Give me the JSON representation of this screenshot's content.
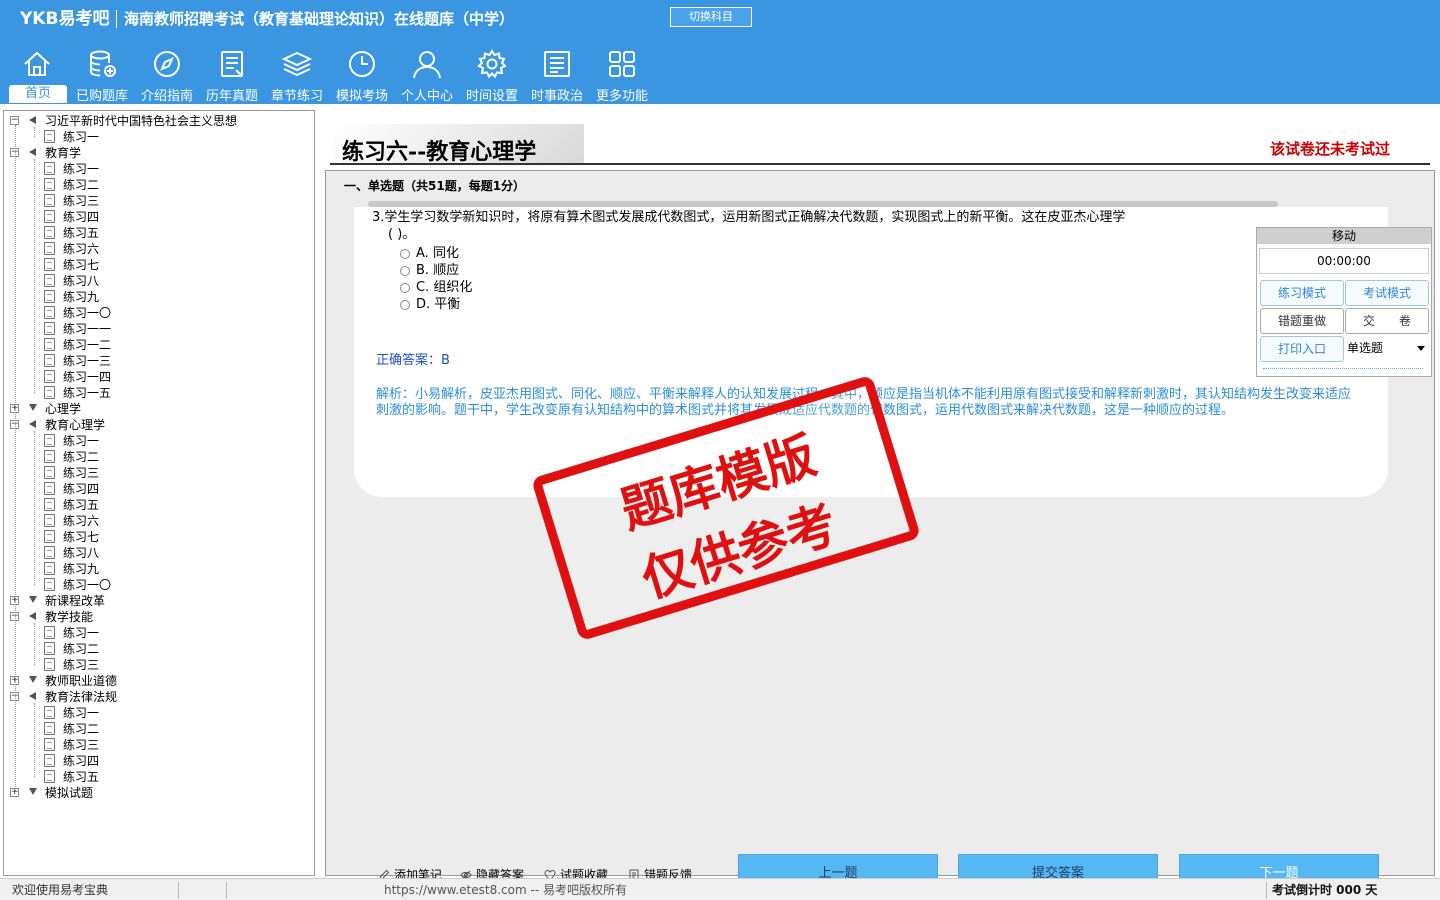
{
  "header": {
    "logo": "YKB易考吧",
    "title": "海南教师招聘考试（教育基础理论知识）在线题库（中学）",
    "switch_subject": "切换科目"
  },
  "nav": [
    {
      "label": "首页",
      "icon": "home-icon",
      "active": true
    },
    {
      "label": "已购题库",
      "icon": "database-icon"
    },
    {
      "label": "介绍指南",
      "icon": "compass-icon"
    },
    {
      "label": "历年真题",
      "icon": "document-list-icon"
    },
    {
      "label": "章节练习",
      "icon": "layers-icon"
    },
    {
      "label": "模拟考场",
      "icon": "clock-icon"
    },
    {
      "label": "个人中心",
      "icon": "user-icon"
    },
    {
      "label": "时间设置",
      "icon": "gear-icon"
    },
    {
      "label": "时事政治",
      "icon": "newspaper-icon"
    },
    {
      "label": "更多功能",
      "icon": "grid-icon"
    }
  ],
  "tree": [
    {
      "label": "习近平新时代中国特色社会主义思想",
      "level": 0,
      "expanded": true
    },
    {
      "label": "练习一",
      "level": 1
    },
    {
      "label": "教育学",
      "level": 0,
      "expanded": true
    },
    {
      "label": "练习一",
      "level": 1
    },
    {
      "label": "练习二",
      "level": 1
    },
    {
      "label": "练习三",
      "level": 1
    },
    {
      "label": "练习四",
      "level": 1
    },
    {
      "label": "练习五",
      "level": 1
    },
    {
      "label": "练习六",
      "level": 1
    },
    {
      "label": "练习七",
      "level": 1
    },
    {
      "label": "练习八",
      "level": 1
    },
    {
      "label": "练习九",
      "level": 1
    },
    {
      "label": "练习一〇",
      "level": 1
    },
    {
      "label": "练习一一",
      "level": 1
    },
    {
      "label": "练习一二",
      "level": 1
    },
    {
      "label": "练习一三",
      "level": 1
    },
    {
      "label": "练习一四",
      "level": 1
    },
    {
      "label": "练习一五",
      "level": 1
    },
    {
      "label": "心理学",
      "level": 0,
      "expanded": false
    },
    {
      "label": "教育心理学",
      "level": 0,
      "expanded": true
    },
    {
      "label": "练习一",
      "level": 1
    },
    {
      "label": "练习二",
      "level": 1
    },
    {
      "label": "练习三",
      "level": 1
    },
    {
      "label": "练习四",
      "level": 1
    },
    {
      "label": "练习五",
      "level": 1
    },
    {
      "label": "练习六",
      "level": 1,
      "selected": true
    },
    {
      "label": "练习七",
      "level": 1
    },
    {
      "label": "练习八",
      "level": 1
    },
    {
      "label": "练习九",
      "level": 1
    },
    {
      "label": "练习一〇",
      "level": 1
    },
    {
      "label": "新课程改革",
      "level": 0,
      "expanded": false
    },
    {
      "label": "教学技能",
      "level": 0,
      "expanded": true
    },
    {
      "label": "练习一",
      "level": 1
    },
    {
      "label": "练习二",
      "level": 1
    },
    {
      "label": "练习三",
      "level": 1
    },
    {
      "label": "教师职业道德",
      "level": 0,
      "expanded": false
    },
    {
      "label": "教育法律法规",
      "level": 0,
      "expanded": true
    },
    {
      "label": "练习一",
      "level": 1
    },
    {
      "label": "练习二",
      "level": 1
    },
    {
      "label": "练习三",
      "level": 1
    },
    {
      "label": "练习四",
      "level": 1
    },
    {
      "label": "练习五",
      "level": 1
    },
    {
      "label": "模拟试题",
      "level": 0,
      "expanded": false
    }
  ],
  "paper": {
    "title": "练习六--教育心理学",
    "status": "该试卷还未考试过",
    "section": "一、单选题（共51题，每题1分）"
  },
  "question": {
    "stem": "3.学生学习数学新知识时，将原有算术图式发展成代数图式，运用新图式正确解决代数题，实现图式上的新平衡。这在皮亚杰心理学",
    "stem_tail": "( )。",
    "options": [
      {
        "key": "A.",
        "text": "同化"
      },
      {
        "key": "B.",
        "text": "顺应"
      },
      {
        "key": "C.",
        "text": "组织化"
      },
      {
        "key": "D.",
        "text": "平衡"
      }
    ],
    "answer_label": "正确答案：",
    "answer": "B",
    "analysis": "解析：小易解析，皮亚杰用图式、同化、顺应、平衡来解释人的认知发展过程。其中，顺应是指当机体不能利用原有图式接受和解释新刺激时，其认知结构发生改变来适应刺激的影响。题干中，学生改变原有认知结构中的算术图式并将其发展成适应代数题的代数图式，运用代数图式来解决代数题，这是一种顺应的过程。"
  },
  "watermark": {
    "line1": "题库模版",
    "line2": "仅供参考"
  },
  "control": {
    "move": "移动",
    "timer": "00:00:00",
    "practice_mode": "练习模式",
    "exam_mode": "考试模式",
    "redo_wrong": "错题重做",
    "submit_paper": "交　　卷",
    "print": "打印入口",
    "type_select": "单选题"
  },
  "actions": {
    "add_note": "添加笔记",
    "hide_answer": "隐藏答案",
    "favorite": "试题收藏",
    "feedback": "错题反馈",
    "prev": "上一题",
    "submit": "提交答案",
    "next": "下一题"
  },
  "status": {
    "welcome": "欢迎使用易考宝典",
    "copyright": "https://www.etest8.com -- 易考吧版权所有",
    "countdown": "考试倒计时 000 天"
  },
  "colors": {
    "header": "#3a96e0",
    "button": "#55b8f3",
    "status_red": "#cc0000",
    "analysis": "#2b8fd8"
  }
}
